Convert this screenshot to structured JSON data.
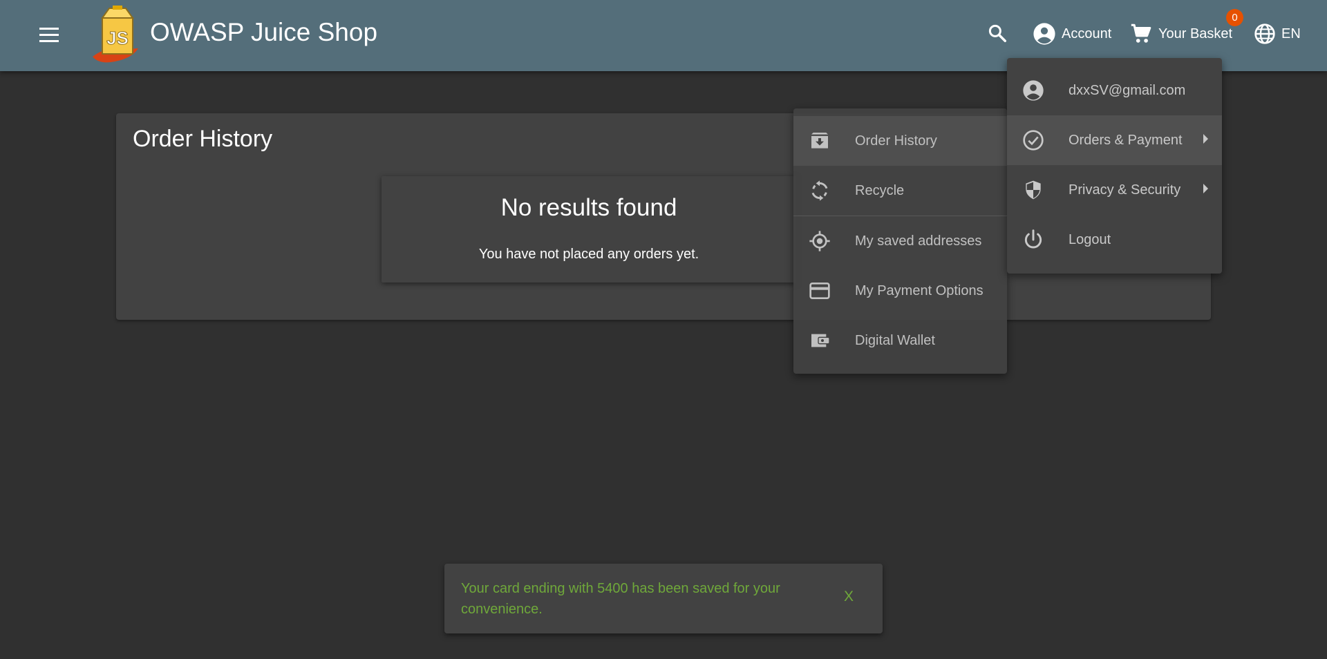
{
  "header": {
    "app_title": "OWASP Juice Shop",
    "logo_text": "JS",
    "account_label": "Account",
    "basket_label": "Your Basket",
    "basket_count": "0",
    "language_label": "EN",
    "icons": [
      "menu-icon",
      "search-icon",
      "account-circle-icon",
      "cart-icon",
      "globe-icon"
    ]
  },
  "main": {
    "title": "Order History",
    "empty_title": "No results found",
    "empty_message": "You have not placed any orders yet."
  },
  "account_menu": {
    "items": [
      {
        "label": "dxxSV@gmail.com",
        "icon": "account-circle-icon"
      },
      {
        "label": "Orders & Payment",
        "icon": "check-circle-icon",
        "submenu": true
      },
      {
        "label": "Privacy & Security",
        "icon": "shield-icon",
        "submenu": true
      },
      {
        "label": "Logout",
        "icon": "power-icon"
      }
    ]
  },
  "orders_submenu": {
    "items": [
      {
        "label": "Order History",
        "icon": "archive-icon"
      },
      {
        "label": "Recycle",
        "icon": "recycle-icon"
      },
      {
        "label": "My saved addresses",
        "icon": "location-icon"
      },
      {
        "label": "My Payment Options",
        "icon": "credit-card-icon"
      },
      {
        "label": "Digital Wallet",
        "icon": "wallet-icon"
      }
    ]
  },
  "snackbar": {
    "message": "Your card ending with 5400 has been saved for your convenience.",
    "close_label": "X"
  },
  "colors": {
    "toolbar": "#546e7a",
    "background": "#303030",
    "card": "#424242",
    "badge": "#e65100",
    "snackbar_text": "#6fa83a"
  }
}
